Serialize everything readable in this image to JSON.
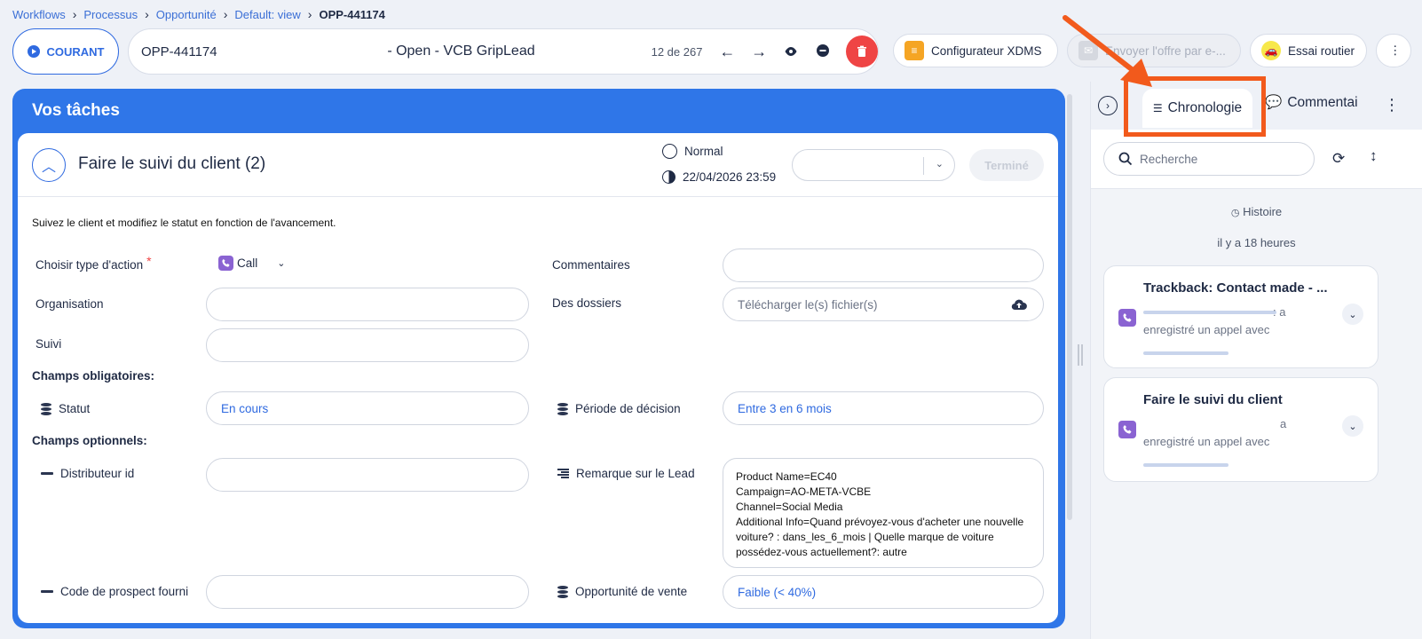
{
  "breadcrumb": [
    "Workflows",
    "Processus",
    "Opportunité",
    "Default: view",
    "OPP-441174"
  ],
  "status": {
    "label": "COURANT"
  },
  "record": {
    "id": "OPP-441174",
    "title": "- Open - VCB GripLead",
    "count": "12 de 267"
  },
  "actions": {
    "configurator": "Configurateur XDMS",
    "send_offer": "Envoyer l'offre par e-...",
    "test_drive": "Essai routier"
  },
  "tasks": {
    "header": "Vos tâches",
    "task_title": "Faire le suivi du client (2)",
    "priority": "Normal",
    "deadline": "22/04/2026 23:59",
    "done_label": "Terminé",
    "description": "Suivez le client et modifiez le statut en fonction de l'avancement.",
    "fields": {
      "action_type_label": "Choisir type d'action",
      "action_type_value": "Call",
      "organisation_label": "Organisation",
      "follow_label": "Suivi",
      "comments_label": "Commentaires",
      "files_label": "Des dossiers",
      "files_placeholder": "Télécharger le(s) fichier(s)",
      "required_section": "Champs obligatoires:",
      "status_label": "Statut",
      "status_value": "En cours",
      "decision_label": "Période de décision",
      "decision_value": "Entre 3 en 6 mois",
      "optional_section": "Champs optionnels:",
      "distributor_label": "Distributeur id",
      "remark_label": "Remarque sur le Lead",
      "remark_lines": [
        "Product Name=EC40",
        "Campaign=AO-META-VCBE",
        "Channel=Social Media",
        "Additional Info=Quand prévoyez-vous d'acheter une nouvelle",
        "voiture? : dans_les_6_mois |  Quelle marque de voiture",
        "possédez-vous actuellement?: autre"
      ],
      "prospect_code_label": "Code de prospect fourni",
      "sale_opportunity_label": "Opportunité de vente",
      "sale_opportunity_value": "Faible (< 40%)"
    }
  },
  "side": {
    "tab_timeline": "Chronologie",
    "tab_comments": "Commentaires",
    "search_placeholder": "Recherche",
    "history_label": "Histoire",
    "time_label": "il y a 18 heures",
    "items": [
      {
        "title": "Trackback: Contact made - ...",
        "line1": ": a",
        "line2": "enregistré un appel avec"
      },
      {
        "title": "Faire le suivi du client",
        "line1": "a",
        "line2": "enregistré un appel avec"
      }
    ]
  },
  "colors": {
    "accent": "#2f76e8",
    "delete": "#ef4444",
    "highlight": "#f25a1c",
    "call": "#8a63d2"
  }
}
